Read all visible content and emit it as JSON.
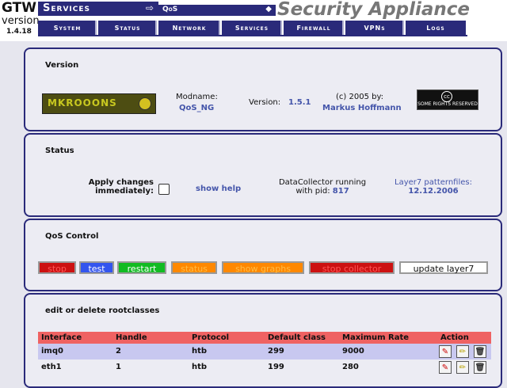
{
  "header": {
    "brand": "GTW",
    "brand_version_label": "version",
    "brand_version": "1.4.18",
    "services_label": "Services",
    "services_arrow": "⇨",
    "current_service": "QoS",
    "current_service_arrow": "◆",
    "app_title": "Security Appliance"
  },
  "tabs": [
    "System",
    "Status",
    "Network",
    "Services",
    "Firewall",
    "VPNs",
    "Logs"
  ],
  "version_section": {
    "heading": "Version",
    "logo_text": "MKROOONS",
    "modname_label": "Modname:",
    "modname_value": "QoS_NG",
    "version_label": "Version:",
    "version_value": "1.5.1",
    "copyright_label": "(c) 2005 by:",
    "author": "Markus Hoffmann",
    "cc_badge_text": "SOME RIGHTS RESERVED",
    "cc_symbol": "cc"
  },
  "status_section": {
    "heading": "Status",
    "apply_label_line1": "Apply changes",
    "apply_label_line2": "immediately:",
    "apply_checked": false,
    "help_link": "show help",
    "collector_line1": "DataCollector running",
    "collector_line2_prefix": "with pid:",
    "collector_pid": "817",
    "layer7_label": "Layer7 patternfiles:",
    "layer7_date": "12.12.2006"
  },
  "qos_control": {
    "heading": "QoS Control",
    "buttons": [
      {
        "label": "stop",
        "bg": "#cc1111",
        "fg": "#ff5555"
      },
      {
        "label": "test",
        "bg": "#3355ee",
        "fg": "#ffffff"
      },
      {
        "label": "restart",
        "bg": "#11bb22",
        "fg": "#ffffff"
      },
      {
        "label": "status",
        "bg": "#ff8800",
        "fg": "#ffbb44"
      },
      {
        "label": "show graphs",
        "bg": "#ff8800",
        "fg": "#ffbb44"
      },
      {
        "label": "stop collector",
        "bg": "#cc1111",
        "fg": "#ff5555"
      },
      {
        "label": "update layer7",
        "bg": "#ffffff",
        "fg": "#111111"
      }
    ]
  },
  "rootclasses": {
    "heading": "edit or delete rootclasses",
    "columns": [
      "Interface",
      "Handle",
      "Protocol",
      "Default class",
      "Maximum Rate",
      "Action"
    ],
    "rows": [
      {
        "interface": "imq0",
        "handle": "2",
        "protocol": "htb",
        "default_class": "299",
        "max_rate": "9000"
      },
      {
        "interface": "eth1",
        "handle": "1",
        "protocol": "htb",
        "default_class": "199",
        "max_rate": "280"
      }
    ],
    "action_icons": [
      "add-class-icon",
      "edit-icon",
      "delete-icon"
    ]
  },
  "colors": {
    "nav_dark": "#2a2a7a",
    "panel_bg": "#ececf3",
    "table_header": "#ef6262",
    "row_highlight": "#c8c8f0",
    "link_blue": "#4455aa"
  }
}
